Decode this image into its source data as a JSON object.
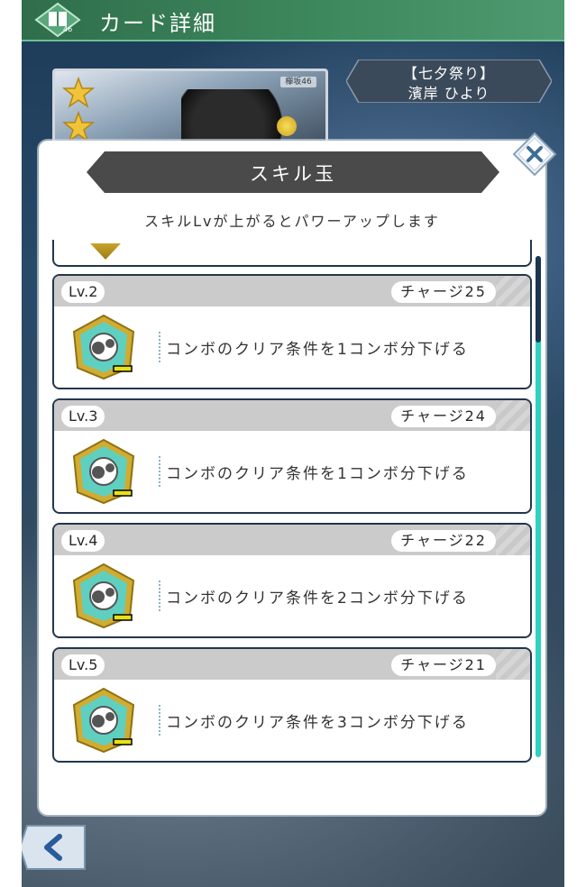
{
  "header": {
    "title": "カード詳細",
    "icon_badge": "46"
  },
  "card": {
    "event_name": "【七夕祭り】",
    "member_name": "濱岸 ひより",
    "logo_text": "欅坂46"
  },
  "modal": {
    "title": "スキル玉",
    "subtitle": "スキルLvが上がるとパワーアップします",
    "close_icon": "close-x-icon"
  },
  "skills": [
    {
      "level": "Lv.2",
      "charge": "チャージ25",
      "description": "コンボのクリア条件を1コンボ分下げる"
    },
    {
      "level": "Lv.3",
      "charge": "チャージ24",
      "description": "コンボのクリア条件を1コンボ分下げる"
    },
    {
      "level": "Lv.4",
      "charge": "チャージ22",
      "description": "コンボのクリア条件を2コンボ分下げる"
    },
    {
      "level": "Lv.5",
      "charge": "チャージ21",
      "description": "コンボのクリア条件を3コンボ分下げる"
    }
  ],
  "colors": {
    "accent_teal": "#2fd1c0",
    "header_green": "#3f8a5e",
    "banner_gray": "#4a4a4a",
    "card_border": "#22364d"
  },
  "icons": {
    "back": "chevron-left-icon",
    "skill": "combo-skill-icon",
    "star": "star-icon"
  }
}
